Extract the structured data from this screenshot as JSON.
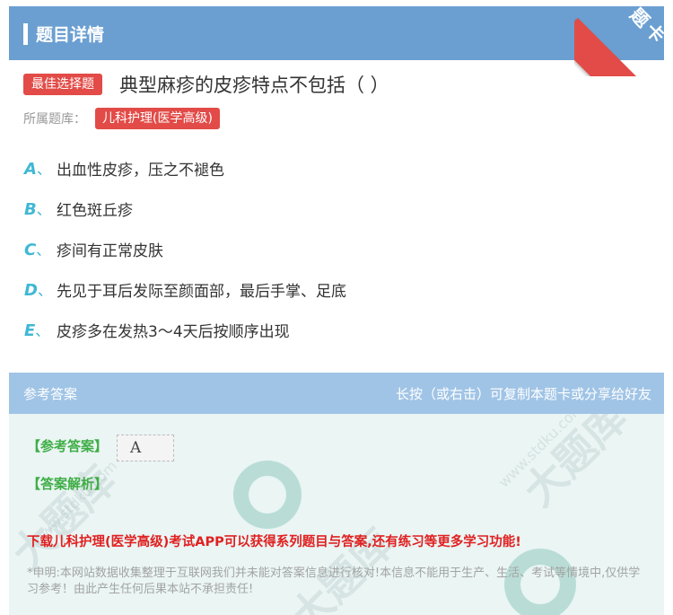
{
  "header": {
    "title": "题目详情",
    "ribbon": "题卡"
  },
  "question": {
    "type_tag": "最佳选择题",
    "text": "典型麻疹的皮疹特点不包括（ ）",
    "bank_label": "所属题库：",
    "bank": "儿科护理(医学高级)"
  },
  "options": [
    {
      "letter": "A",
      "sep": "、",
      "text": "出血性皮疹，压之不褪色"
    },
    {
      "letter": "B",
      "sep": "、",
      "text": "红色斑丘疹"
    },
    {
      "letter": "C",
      "sep": "、",
      "text": "疹间有正常皮肤"
    },
    {
      "letter": "D",
      "sep": "、",
      "text": "先见于耳后发际至颜面部，最后手掌、足底"
    },
    {
      "letter": "E",
      "sep": "、",
      "text": "皮疹多在发热3～4天后按顺序出现"
    }
  ],
  "answer": {
    "section_title": "参考答案",
    "hint": "长按（或右击）可复制本题卡或分享给好友",
    "answer_label": "【参考答案】",
    "answer_value": "A",
    "explain_label": "【答案解析】",
    "promo": "下载儿科护理(医学高级)考试APP可以获得系列题目与答案,还有练习等更多学习功能!",
    "notice": "*申明:本网站数据收集整理于互联网我们并未能对答案信息进行核对!本信息不能用于生产、生活、考试等情境中,仅供学习参考！由此产生任何后果本站不承担责任!"
  },
  "watermark": {
    "big": "大题库",
    "small": "www.stdku.com"
  },
  "colors": {
    "header": "#6b9fd1",
    "accent_red": "#e24b47",
    "option_letter": "#3fb8d4",
    "answer_green": "#3fae46"
  }
}
